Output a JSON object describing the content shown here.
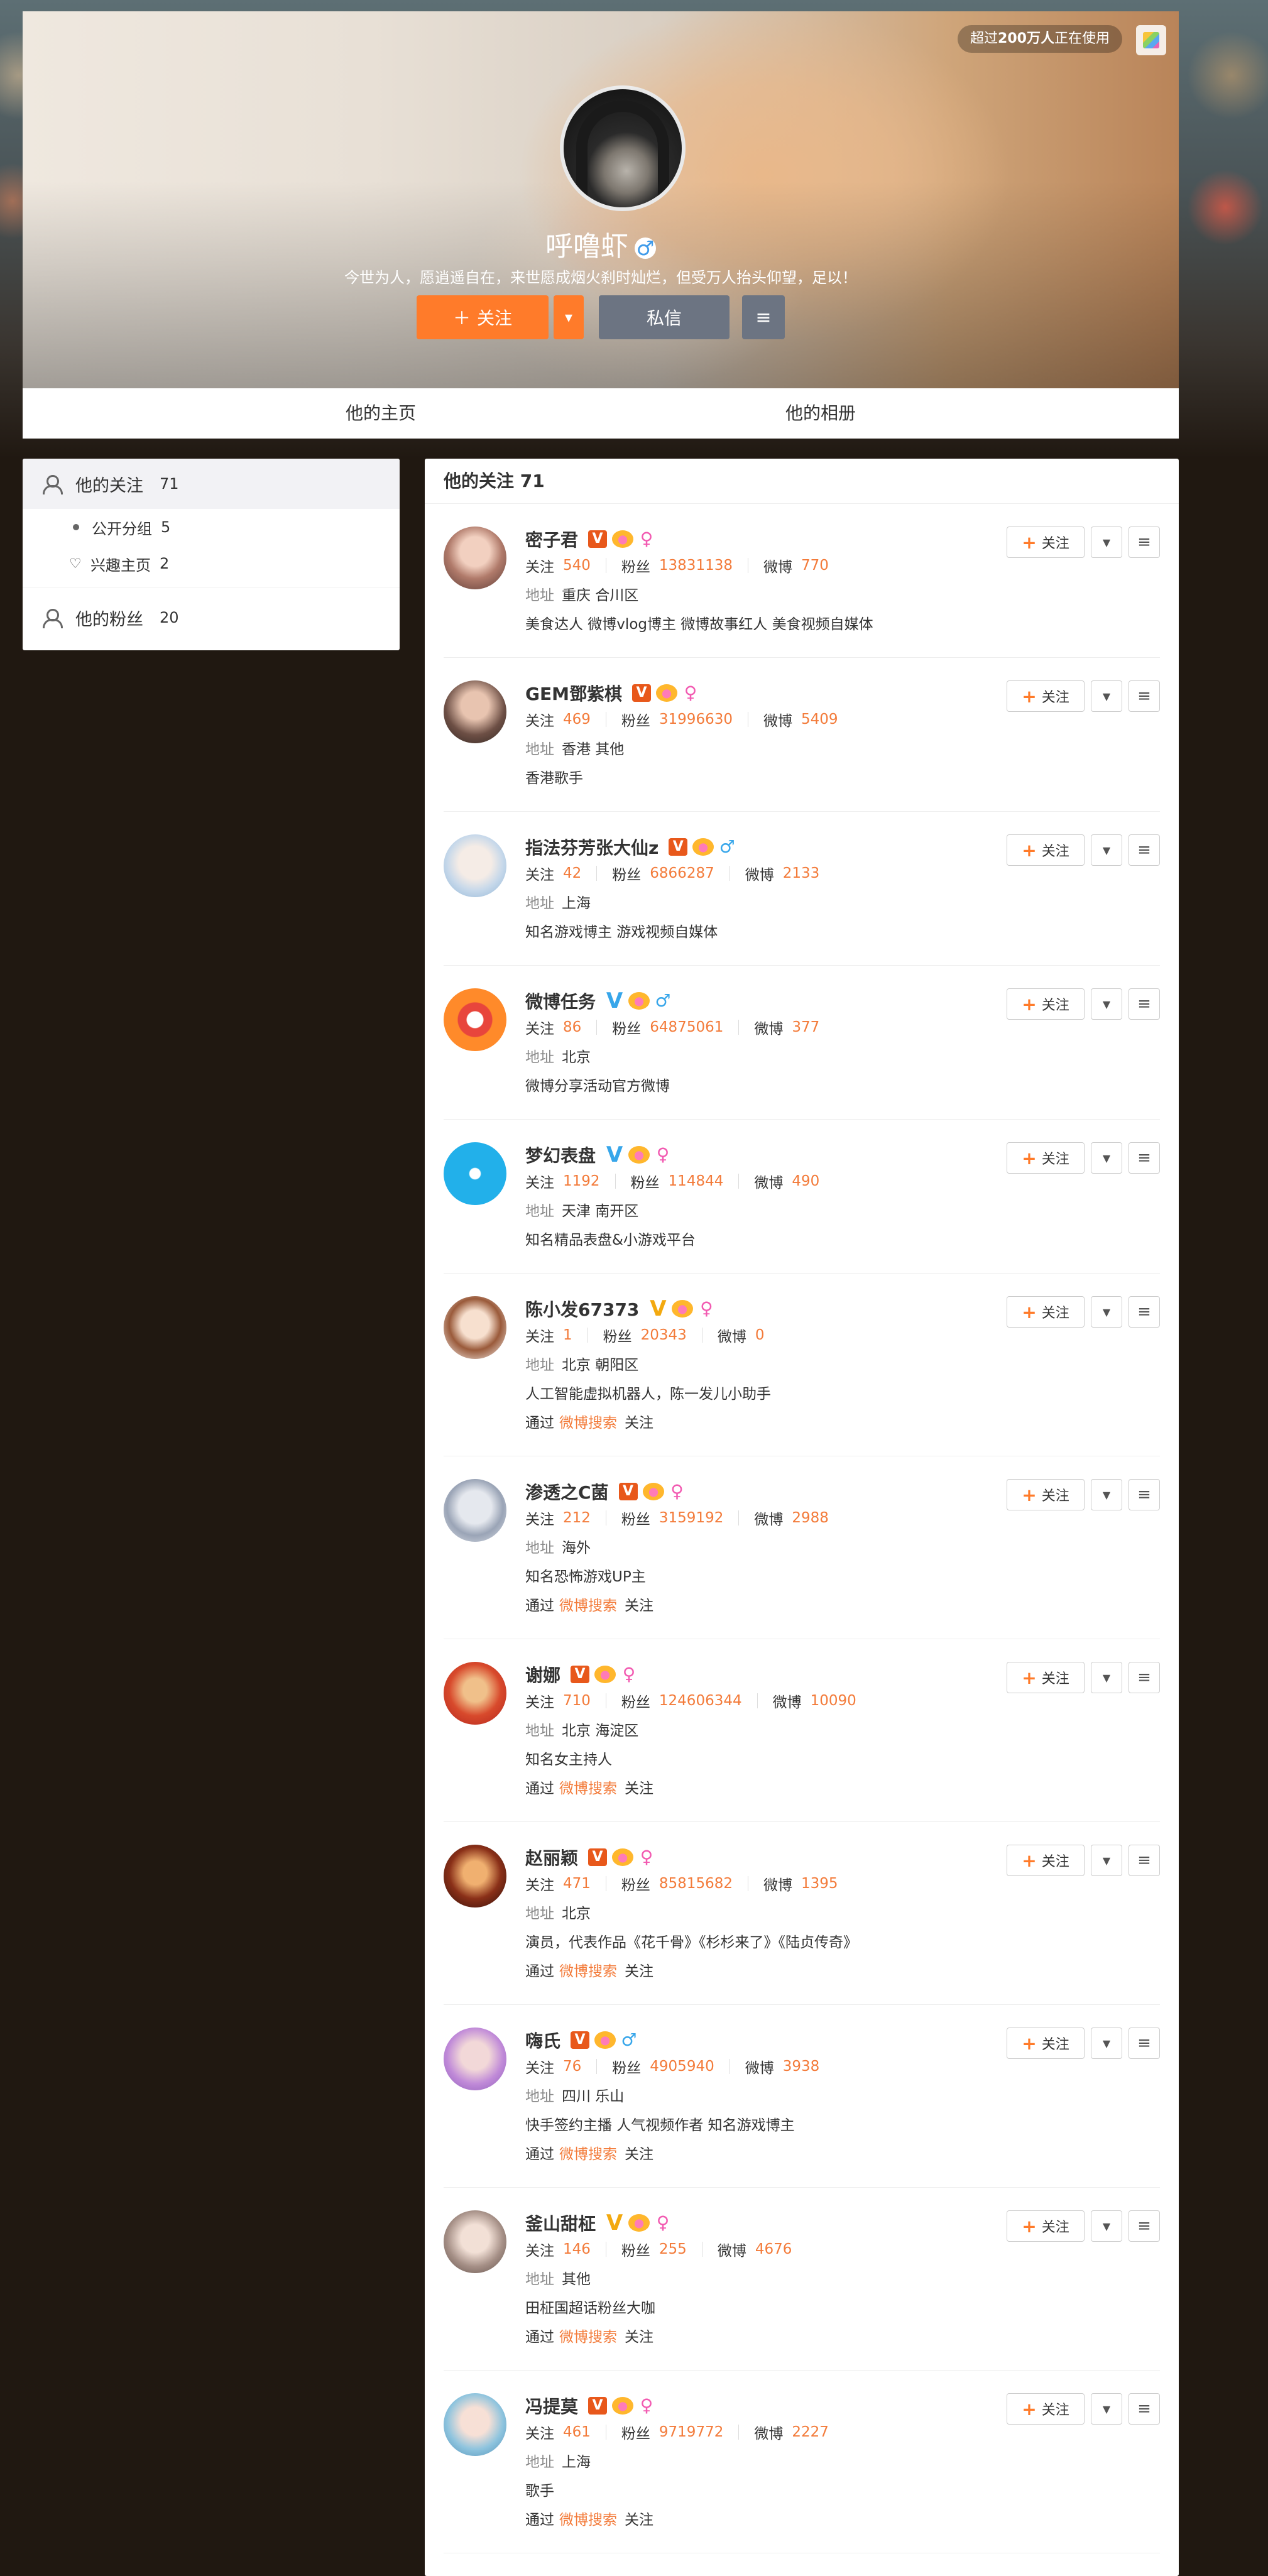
{
  "header": {
    "usage_badge_prefix": "超过",
    "usage_badge_bold": "200万人",
    "usage_badge_suffix": "正在使用",
    "user_name": "呼噜虾",
    "gender_symbol": "♂",
    "bio": "今世为人，愿逍遥自在，来世愿成烟火刹时灿烂，但受万人抬头仰望，足以！",
    "follow_label": "关注",
    "message_label": "私信"
  },
  "tabs": [
    {
      "label": "他的主页"
    },
    {
      "label": "他的相册"
    }
  ],
  "sidebar": {
    "following_label": "他的关注",
    "following_count": "71",
    "group_label": "公开分组",
    "group_count": "5",
    "interest_label": "兴趣主页",
    "interest_count": "2",
    "fans_label": "他的粉丝",
    "fans_count": "20"
  },
  "main": {
    "title": "他的关注 71",
    "follow_btn_label": "关注",
    "stat_labels": {
      "following": "关注",
      "fans": "粉丝",
      "weibo": "微博",
      "address": "地址",
      "via": "通过",
      "via_suffix": "关注"
    },
    "items": [
      {
        "name": "密子君",
        "badge": "orange",
        "gender": "female",
        "following": "540",
        "fans": "13831138",
        "weibo": "770",
        "address": "重庆 合川区",
        "desc": "美食达人 微博vlog博主 微博故事红人 美食视频自媒体",
        "via": ""
      },
      {
        "name": "GEM鄧紫棋",
        "badge": "orange",
        "gender": "female",
        "following": "469",
        "fans": "31996630",
        "weibo": "5409",
        "address": "香港 其他",
        "desc": "香港歌手",
        "via": ""
      },
      {
        "name": "指法芬芳张大仙z",
        "badge": "orange",
        "gender": "male",
        "following": "42",
        "fans": "6866287",
        "weibo": "2133",
        "address": "上海",
        "desc": "知名游戏博主 游戏视频自媒体",
        "via": ""
      },
      {
        "name": "微博任务",
        "badge": "blue",
        "gender": "male",
        "following": "86",
        "fans": "64875061",
        "weibo": "377",
        "address": "北京",
        "desc": "微博分享活动官方微博",
        "via": ""
      },
      {
        "name": "梦幻表盘",
        "badge": "blue",
        "gender": "female",
        "following": "1192",
        "fans": "114844",
        "weibo": "490",
        "address": "天津 南开区",
        "desc": "知名精品表盘&小游戏平台",
        "via": ""
      },
      {
        "name": "陈小发67373",
        "badge": "gold",
        "gender": "female",
        "following": "1",
        "fans": "20343",
        "weibo": "0",
        "address": "北京 朝阳区",
        "desc": "人工智能虚拟机器人，陈一发儿小助手",
        "via": "微博搜索"
      },
      {
        "name": "渗透之C菌",
        "badge": "orange",
        "gender": "female",
        "following": "212",
        "fans": "3159192",
        "weibo": "2988",
        "address": "海外",
        "desc": "知名恐怖游戏UP主",
        "via": "微博搜索"
      },
      {
        "name": "谢娜",
        "badge": "orange",
        "gender": "female",
        "following": "710",
        "fans": "124606344",
        "weibo": "10090",
        "address": "北京 海淀区",
        "desc": "知名女主持人",
        "via": "微博搜索"
      },
      {
        "name": "赵丽颖",
        "badge": "orange",
        "gender": "female",
        "following": "471",
        "fans": "85815682",
        "weibo": "1395",
        "address": "北京",
        "desc": "演员，代表作品《花千骨》《杉杉来了》《陆贞传奇》",
        "via": "微博搜索"
      },
      {
        "name": "嗨氏",
        "badge": "orange",
        "gender": "male",
        "following": "76",
        "fans": "4905940",
        "weibo": "3938",
        "address": "四川 乐山",
        "desc": "快手签约主播 人气视频作者 知名游戏博主",
        "via": "微博搜索"
      },
      {
        "name": "釜山甜柾",
        "badge": "gold",
        "gender": "female",
        "following": "146",
        "fans": "255",
        "weibo": "4676",
        "address": "其他",
        "desc": "田柾国超话粉丝大咖",
        "via": "微博搜索"
      },
      {
        "name": "冯提莫",
        "badge": "orange",
        "gender": "female",
        "following": "461",
        "fans": "9719772",
        "weibo": "2227",
        "address": "上海",
        "desc": "歌手",
        "via": "微博搜索"
      }
    ]
  },
  "colors": {
    "accent": "#ff7b2a",
    "stat_number": "#f37b3a",
    "button_grey": "#6c7482",
    "page_bg": "#201811"
  },
  "icons": {
    "people": "people-icon",
    "heart": "heart-outline-icon",
    "menu": "hamburger-icon",
    "dropdown": "caret-down-icon",
    "plus": "plus-icon"
  }
}
